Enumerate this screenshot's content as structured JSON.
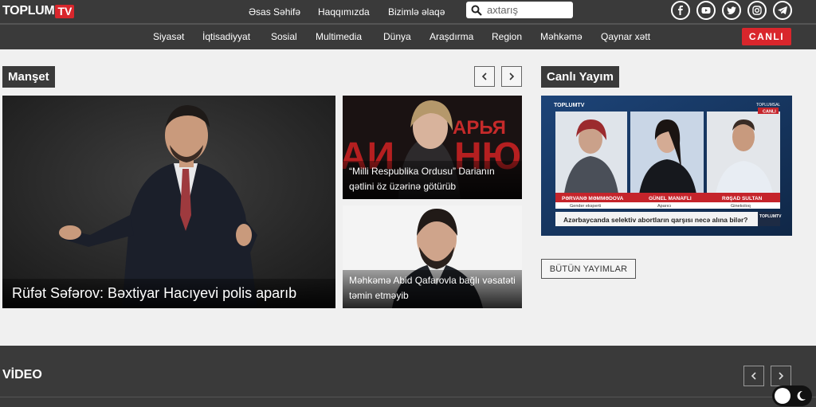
{
  "header": {
    "logo_text": "TOPLUM",
    "logo_tv": "TV",
    "nav": [
      "Əsas Səhifə",
      "Haqqımızda",
      "Bizimlə əlaqə"
    ],
    "search_placeholder": "axtarış",
    "social": [
      "facebook-icon",
      "youtube-icon",
      "twitter-icon",
      "instagram-icon",
      "telegram-icon"
    ]
  },
  "categories": [
    "Siyasət",
    "İqtisadiyyat",
    "Sosial",
    "Multimedia",
    "Dünya",
    "Araşdırma",
    "Region",
    "Məhkəmə",
    "Qaynar xətt"
  ],
  "live_button": "CANLI",
  "manset": {
    "title": "Manşet",
    "main_story": "Rüfət Səfərov: Bəxtiyar Hacıyevi polis aparıb",
    "side_stories": [
      "“Milli Respublika Ordusu” Darianın qətlini öz üzərinə götürüb",
      "Məhkəmə Abid Qafarovla bağlı vəsatəti təmin etməyib"
    ]
  },
  "live": {
    "title": "Canlı Yayım",
    "all_button": "BÜTÜN YAYIMLAR",
    "screen": {
      "channel": "TOPLUMTV",
      "badge_top": "TOPLUMSAL",
      "badge_canli": "CANLI",
      "guests": [
        {
          "name": "PƏRVANƏ MƏMMƏDOVA",
          "role": "Gender eksperti"
        },
        {
          "name": "GÜNEL MANAFLI",
          "role": "Aparıcı"
        },
        {
          "name": "RƏŞAD SULTAN",
          "role": "Ginekoloq"
        }
      ],
      "ticker": "Azərbaycanda selektiv abortların qarşısı necə alına bilər?",
      "ticker_logo": "TOPLUMTV"
    }
  },
  "video": {
    "title": "VİDEO"
  },
  "colors": {
    "bar": "#3a3a3a",
    "accent": "#d9262c",
    "page": "#f0f0f0"
  }
}
